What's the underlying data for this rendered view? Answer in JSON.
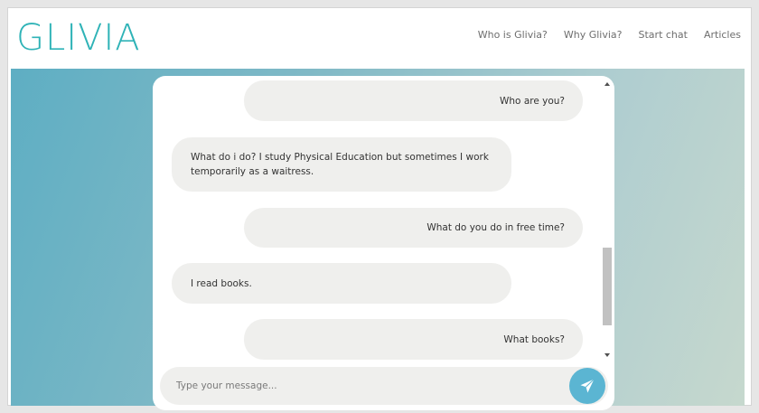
{
  "header": {
    "logo_text": "GLIVIA",
    "nav": [
      {
        "label": "Who is Glivia?"
      },
      {
        "label": "Why Glivia?"
      },
      {
        "label": "Start chat"
      },
      {
        "label": "Articles"
      }
    ]
  },
  "colors": {
    "brand": "#2fb3b7",
    "send_button": "#5bb5d2",
    "bubble": "#efefed"
  },
  "chat": {
    "messages": [
      {
        "sender": "user",
        "text": "Who are you?"
      },
      {
        "sender": "bot",
        "text": "What do i do? I study Physical Education but sometimes I work temporarily as a waitress."
      },
      {
        "sender": "user",
        "text": "What do you do in free time?"
      },
      {
        "sender": "bot",
        "text": "I read books."
      },
      {
        "sender": "user",
        "text": "What books?"
      }
    ],
    "input": {
      "placeholder": "Type your message...",
      "value": ""
    },
    "send_icon": "paper-plane-icon"
  }
}
